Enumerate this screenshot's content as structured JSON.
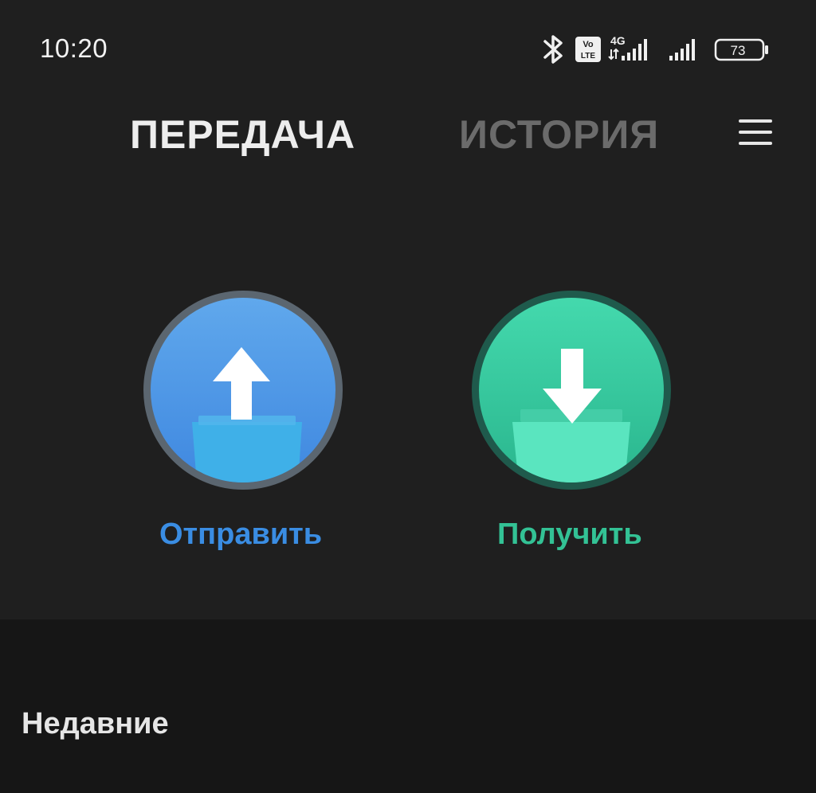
{
  "status_bar": {
    "time": "10:20",
    "volte_label": "Vo LTE",
    "network_label": "4G",
    "battery_level": "73",
    "icons": [
      "bluetooth-icon",
      "volte-icon",
      "signal-4g-icon",
      "signal-icon",
      "battery-icon"
    ]
  },
  "tabs": [
    {
      "label": "ПЕРЕДАЧА",
      "active": true
    },
    {
      "label": "ИСТОРИЯ",
      "active": false
    }
  ],
  "menu_icon": "hamburger-menu-icon",
  "actions": {
    "send": {
      "label": "Отправить",
      "icon": "upload-folder-icon",
      "color": "#3a8de3"
    },
    "receive": {
      "label": "Получить",
      "icon": "download-folder-icon",
      "color": "#33c295"
    }
  },
  "recent": {
    "title": "Недавние"
  }
}
